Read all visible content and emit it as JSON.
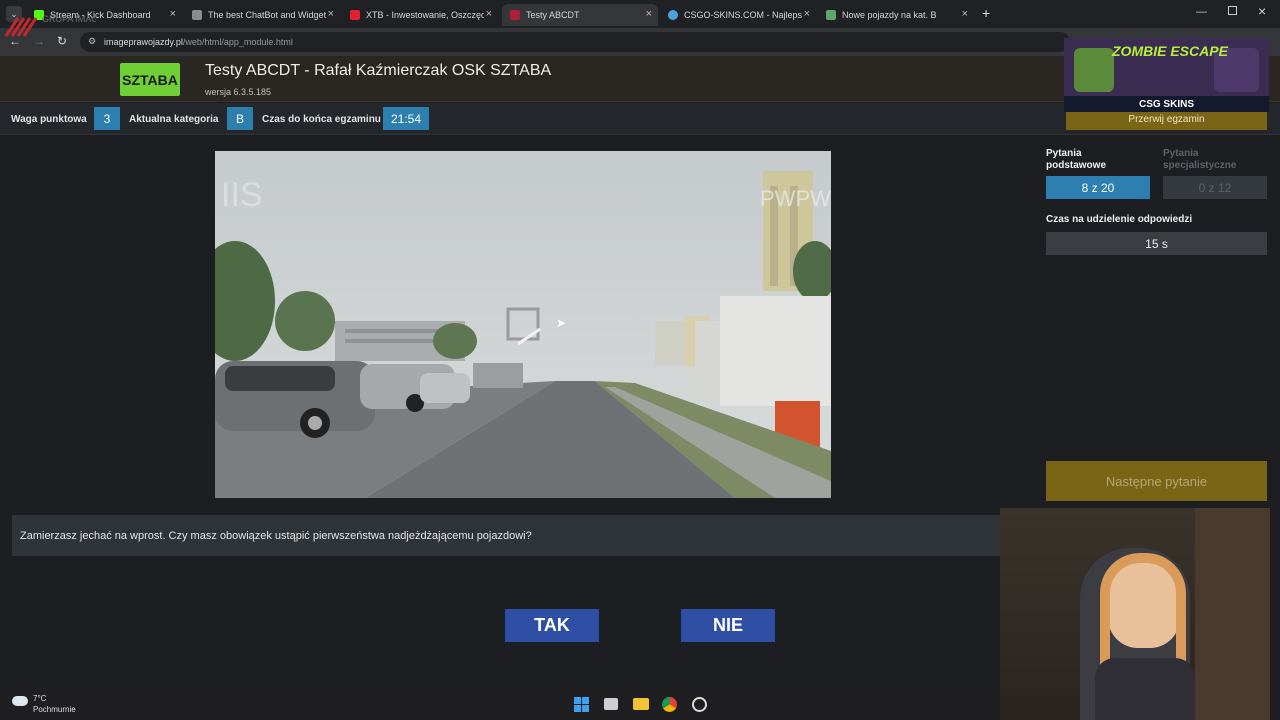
{
  "browser": {
    "tabs": [
      {
        "label": "Stream - Kick Dashboard",
        "icon_color": "#53fc18"
      },
      {
        "label": "The best ChatBot and Widgets",
        "icon_color": "#8c8c8c"
      },
      {
        "label": "XTB - Inwestowanie, Oszczędno",
        "icon_color": "#e3202d"
      },
      {
        "label": "Testy ABCDT",
        "icon_color": "#b01e3a"
      },
      {
        "label": "CSGO-SKINS.COM - Najlepsze",
        "icon_color": "#4aa3df"
      },
      {
        "label": "Nowe pojazdy na kat. B",
        "icon_color": "#5aa86a"
      }
    ],
    "new_tab": "+",
    "url_host": "imageprawojazdy.pl",
    "url_path": "/web/html/app_module.html"
  },
  "header": {
    "brand_logo": "GRUPA IMAGE",
    "school_logo": "SZTABA",
    "title": "Testy ABCDT - Rafał Kaźmierczak OSK SZTABA",
    "version": "wersja 6.3.5.185"
  },
  "infobar": {
    "weight_label": "Waga punktowa",
    "weight_value": "3",
    "category_label": "Aktualna kategoria",
    "category_value": "B",
    "time_label": "Czas do końca egzaminu",
    "time_value": "21:54"
  },
  "panel": {
    "stop_button": "Przerwij egzamin",
    "basic_label": "Pytania podstawowe",
    "basic_value": "8 z 20",
    "special_label": "Pytania specjalistyczne",
    "special_value": "0 z 12",
    "answer_time_label": "Czas na udzielenie odpowiedzi",
    "answer_time_value": "15 s",
    "next_button": "Następne pytanie"
  },
  "question": {
    "text": "Zamierzasz jechać na wprost. Czy masz obowiązek ustąpić pierwszeństwa nadjeżdżającemu pojazdowi?",
    "yes_label": "TAK",
    "no_label": "NIE"
  },
  "promo": {
    "headline": "ZOMBIE ESCAPE",
    "brand": "CSG SKINS"
  },
  "video": {
    "watermark_right": "PWPW",
    "watermark_left": "IIS"
  },
  "weather": {
    "temp": "7°C",
    "desc": "Pochmurnie"
  },
  "colors": {
    "accent_blue": "#2c7fae",
    "answer_blue": "#2e4fa4",
    "gold": "#7a6516"
  }
}
